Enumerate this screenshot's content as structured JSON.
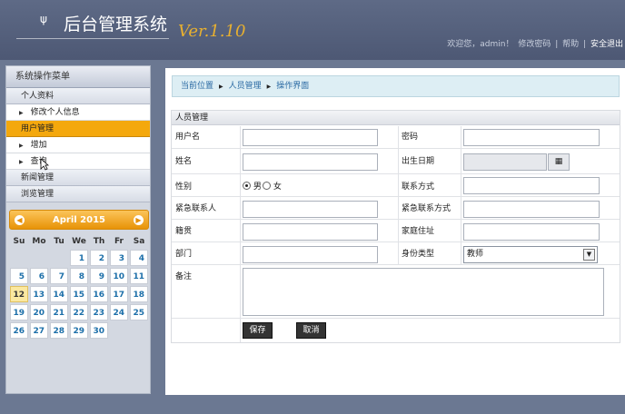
{
  "header": {
    "logo_glyph": "ψ",
    "title": "后台管理系统",
    "version": "Ver.1.10",
    "welcome": "欢迎您，admin！",
    "change_password": "修改密码",
    "sep1": "|",
    "help": "帮助",
    "sep2": "|",
    "logout": "安全退出"
  },
  "sidebar": {
    "title": "系统操作菜单",
    "groups": [
      {
        "label": "个人资料",
        "items": [
          {
            "label": "修改个人信息"
          }
        ]
      },
      {
        "label": "用户管理",
        "items": [
          {
            "label": "增加"
          },
          {
            "label": "查询"
          }
        ]
      },
      {
        "label": "新闻管理"
      },
      {
        "label": "浏览管理"
      }
    ]
  },
  "calendar": {
    "month_label": "April 2015",
    "prev": "◀",
    "next": "▶",
    "dow": [
      "Su",
      "Mo",
      "Tu",
      "We",
      "Th",
      "Fr",
      "Sa"
    ],
    "weeks": [
      [
        "",
        "",
        "",
        "1",
        "2",
        "3",
        "4"
      ],
      [
        "5",
        "6",
        "7",
        "8",
        "9",
        "10",
        "11"
      ],
      [
        "12",
        "13",
        "14",
        "15",
        "16",
        "17",
        "18"
      ],
      [
        "19",
        "20",
        "21",
        "22",
        "23",
        "24",
        "25"
      ],
      [
        "26",
        "27",
        "28",
        "29",
        "30",
        "",
        ""
      ]
    ],
    "today": "12"
  },
  "breadcrumb": {
    "current": "当前位置",
    "level1": "人员管理",
    "level2": "操作界面",
    "sep": "▶"
  },
  "form": {
    "title": "人员管理",
    "username_label": "用户名",
    "password_label": "密码",
    "name_label": "姓名",
    "birthday_label": "出生日期",
    "gender_label": "性别",
    "gender_male": "男",
    "gender_female": "女",
    "contact_label": "联系方式",
    "emergency_contact_label": "紧急联系人",
    "emergency_phone_label": "紧急联系方式",
    "hometown_label": "籍贯",
    "address_label": "家庭住址",
    "department_label": "部门",
    "identity_label": "身份类型",
    "identity_value": "教师",
    "remark_label": "备注",
    "save": "保存",
    "cancel": "取消"
  },
  "icons": {
    "calendar_button": "▦",
    "select_chevron": "▼"
  }
}
